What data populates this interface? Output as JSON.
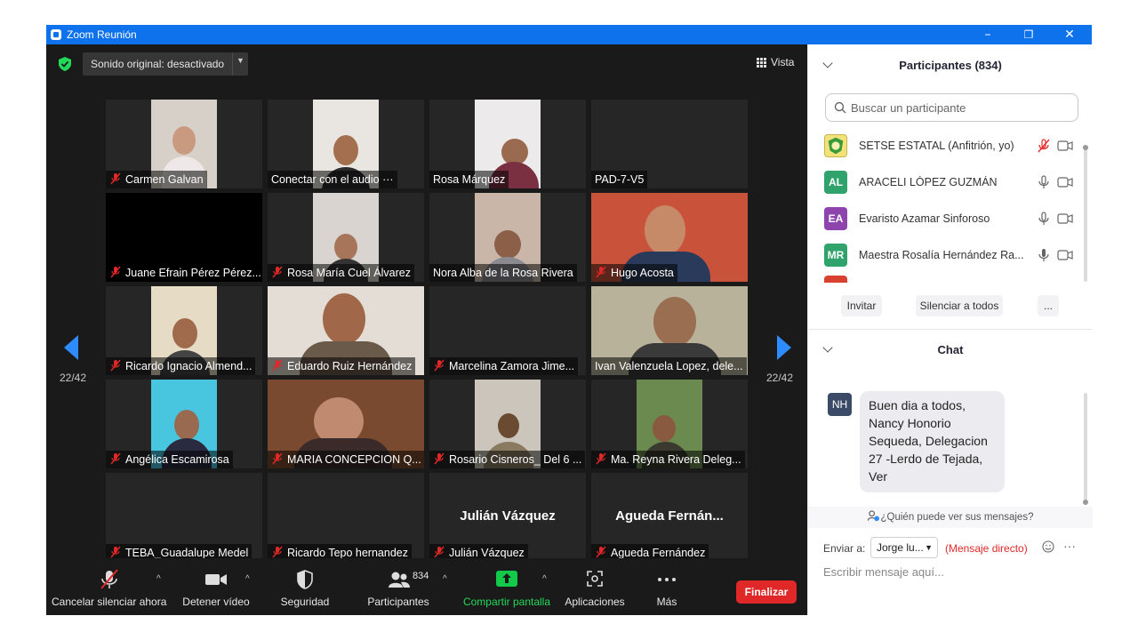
{
  "window": {
    "title": "Zoom Reunión",
    "btn_min": "–",
    "btn_restore": "❐",
    "btn_close": "✕"
  },
  "topbar": {
    "sound": "Sonido original: desactivado",
    "view": "Vista"
  },
  "pagination": {
    "left": "22/42",
    "right": "22/42"
  },
  "tiles": [
    {
      "name": "Carmen Galvan",
      "muted": true
    },
    {
      "name": "Conectar con el audio ···",
      "muted": false
    },
    {
      "name": "Rosa Márquez",
      "muted": false
    },
    {
      "name": "PAD-7-V5",
      "muted": false
    },
    {
      "name": "Juane Efrain Pérez Pérez...",
      "muted": true
    },
    {
      "name": "Rosa María Cuel Álvarez",
      "muted": true
    },
    {
      "name": "Nora Alba de la Rosa Rivera",
      "muted": false
    },
    {
      "name": "Hugo Acosta",
      "muted": true
    },
    {
      "name": "Ricardo Ignacio Almend...",
      "muted": true
    },
    {
      "name": "Eduardo Ruiz Hernández",
      "muted": true
    },
    {
      "name": "Marcelina Zamora Jime...",
      "muted": true
    },
    {
      "name": "Ivan Valenzuela Lopez, dele...",
      "muted": false
    },
    {
      "name": "Angélica Escamirosa",
      "muted": true
    },
    {
      "name": "MARIA CONCEPCION Q...",
      "muted": true
    },
    {
      "name": "Rosario Cisneros_ Del 6 ...",
      "muted": true
    },
    {
      "name": "Ma. Reyna Rivera Deleg...",
      "muted": true
    },
    {
      "name": "TEBA_Guadalupe Medel",
      "muted": true
    },
    {
      "name": "Ricardo Tepo hernandez",
      "muted": true
    },
    {
      "name": "Julián Vázquez",
      "muted": true,
      "big": "Julián Vázquez"
    },
    {
      "name": "Agueda Fernández",
      "muted": true,
      "big": "Agueda  Fernán..."
    }
  ],
  "toolbar": {
    "mute": "Cancelar silenciar ahora",
    "video": "Detener vídeo",
    "security": "Seguridad",
    "participants": "Participantes",
    "participant_count": "834",
    "share": "Compartir pantalla",
    "apps": "Aplicaciones",
    "more": "Más",
    "end": "Finalizar"
  },
  "participants_panel": {
    "title": "Participantes (834)",
    "search_placeholder": "Buscar un participante",
    "rows": [
      {
        "initials": "",
        "name": "SETSE ESTATAL (Anfitrión, yo)",
        "color": "#f2e27a"
      },
      {
        "initials": "AL",
        "name": "ARACELI LÓPEZ GUZMÁN",
        "color": "#2fa36b"
      },
      {
        "initials": "EA",
        "name": "Evaristo Azamar Sinforoso",
        "color": "#8e44ad"
      },
      {
        "initials": "MR",
        "name": "Maestra Rosalía Hernández Ra...",
        "color": "#2fa36b"
      }
    ],
    "invite": "Invitar",
    "mute_all": "Silenciar a todos",
    "more": "..."
  },
  "chat": {
    "title": "Chat",
    "sender_initials": "NH",
    "message": "Buen dia a todos, Nancy Honorio Sequeda, Delegacion 27 -Lerdo de Tejada, Ver",
    "who_can_see": "¿Quién puede ver sus mensajes?",
    "send_to_label": "Enviar a:",
    "recipient": "Jorge lu...",
    "direct": "(Mensaje directo)",
    "more": "···",
    "input_placeholder": "Escribir mensaje aquí..."
  },
  "colors": {
    "accent": "#0e72ed",
    "arrow": "#2d8cff",
    "end": "#e02828",
    "share": "#12c94a",
    "mute_red": "#e02828"
  }
}
